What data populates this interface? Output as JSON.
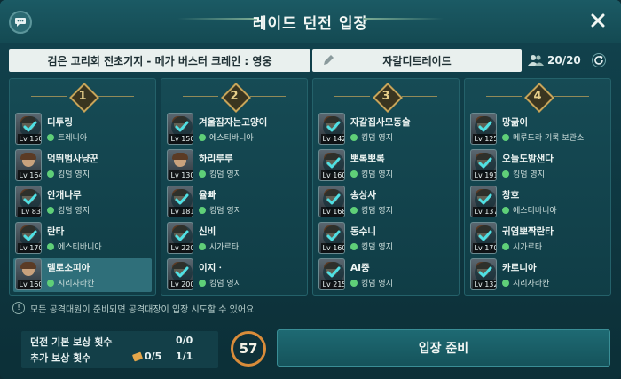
{
  "window": {
    "title": "레이드 던전 입장"
  },
  "info": {
    "dungeon_name": "검은 고리회 전초기지 - 메가 버스터 크레인 : 영웅",
    "party_name": "자갈디트레이드",
    "member_count": "20/20"
  },
  "parties": [
    {
      "number": "1",
      "members": [
        {
          "name": "디투링",
          "level": "Lv 150",
          "server": "트레니아",
          "ready": true
        },
        {
          "name": "먹뛰범사냥꾼",
          "level": "Lv 164",
          "server": "킹덤 영지",
          "ready": false
        },
        {
          "name": "안개나무",
          "level": "Lv 83",
          "server": "킹덤 영지",
          "ready": true
        },
        {
          "name": "란타",
          "level": "Lv 170",
          "server": "에스티바니아",
          "ready": true
        },
        {
          "name": "멜로소피아",
          "level": "Lv 160",
          "server": "시리자라칸",
          "ready": false
        }
      ]
    },
    {
      "number": "2",
      "members": [
        {
          "name": "겨울잠자는고양이",
          "level": "Lv 150",
          "server": "에스티바니아",
          "ready": true
        },
        {
          "name": "하리루루",
          "level": "Lv 130",
          "server": "킹덤 영지",
          "ready": false
        },
        {
          "name": "율빠",
          "level": "Lv 181",
          "server": "킹덤 영지",
          "ready": true
        },
        {
          "name": "신비",
          "level": "Lv 220",
          "server": "시가르타",
          "ready": true
        },
        {
          "name": "이지ㆍ",
          "level": "Lv 200",
          "server": "킹덤 영지",
          "ready": true
        }
      ]
    },
    {
      "number": "3",
      "members": [
        {
          "name": "자갈집사모동술",
          "level": "Lv 142",
          "server": "킹덤 영지",
          "ready": true
        },
        {
          "name": "뽀록뽀록",
          "level": "Lv 160",
          "server": "킹덤 영지",
          "ready": true
        },
        {
          "name": "송상사",
          "level": "Lv 168",
          "server": "킹덤 영지",
          "ready": true
        },
        {
          "name": "동수니",
          "level": "Lv 160",
          "server": "킹덤 영지",
          "ready": true
        },
        {
          "name": "AI중",
          "level": "Lv 215",
          "server": "킹덤 영지",
          "ready": true
        }
      ]
    },
    {
      "number": "4",
      "members": [
        {
          "name": "망굶이",
          "level": "Lv 125",
          "server": "메루도라 기록 보관소",
          "ready": true
        },
        {
          "name": "오늘도밤샌다",
          "level": "Lv 191",
          "server": "킹덤 영지",
          "ready": true
        },
        {
          "name": "창호",
          "level": "Lv 137",
          "server": "에스티바니아",
          "ready": true
        },
        {
          "name": "귀염뽀짝란타",
          "level": "Lv 170",
          "server": "시가르타",
          "ready": true
        },
        {
          "name": "카로니아",
          "level": "Lv 132",
          "server": "시리자라칸",
          "ready": true
        }
      ]
    }
  ],
  "notice": "모든 공격대원이 준비되면 공격대장이 입장 시도할 수 있어요",
  "rewards": {
    "base_label": "던전 기본 보상 횟수",
    "base_value": "0/0",
    "extra_label": "추가 보상 횟수",
    "ticket_value": "0/5",
    "extra_value": "1/1"
  },
  "timer": "57",
  "ready_button": "입장 준비",
  "colors": {
    "accent": "#d98c3a",
    "ready_dot": "#5fcf78",
    "gold": "#c7a55a"
  }
}
